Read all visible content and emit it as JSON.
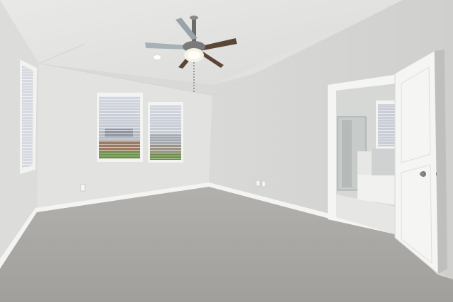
{
  "image": {
    "kind": "photograph",
    "subject": "empty-bedroom"
  },
  "palette": {
    "ceiling": "#e8e8e6",
    "wall_left": "#dfe0de",
    "wall_back": "#e3e4e2",
    "wall_right": "#dcdddb",
    "carpet": "#a9a7a3",
    "carpet_dark": "#9c9a96",
    "baseboard": "#f4f4f2",
    "window_sky": "#c9cdd6",
    "window_lawn": "#6c8f4a",
    "fence": "#9a7a62",
    "fan_blade": "#5b4636",
    "door": "#f5f5f3",
    "bath_tile": "#e6e6e4",
    "bath_wall": "#d6d8d5"
  }
}
